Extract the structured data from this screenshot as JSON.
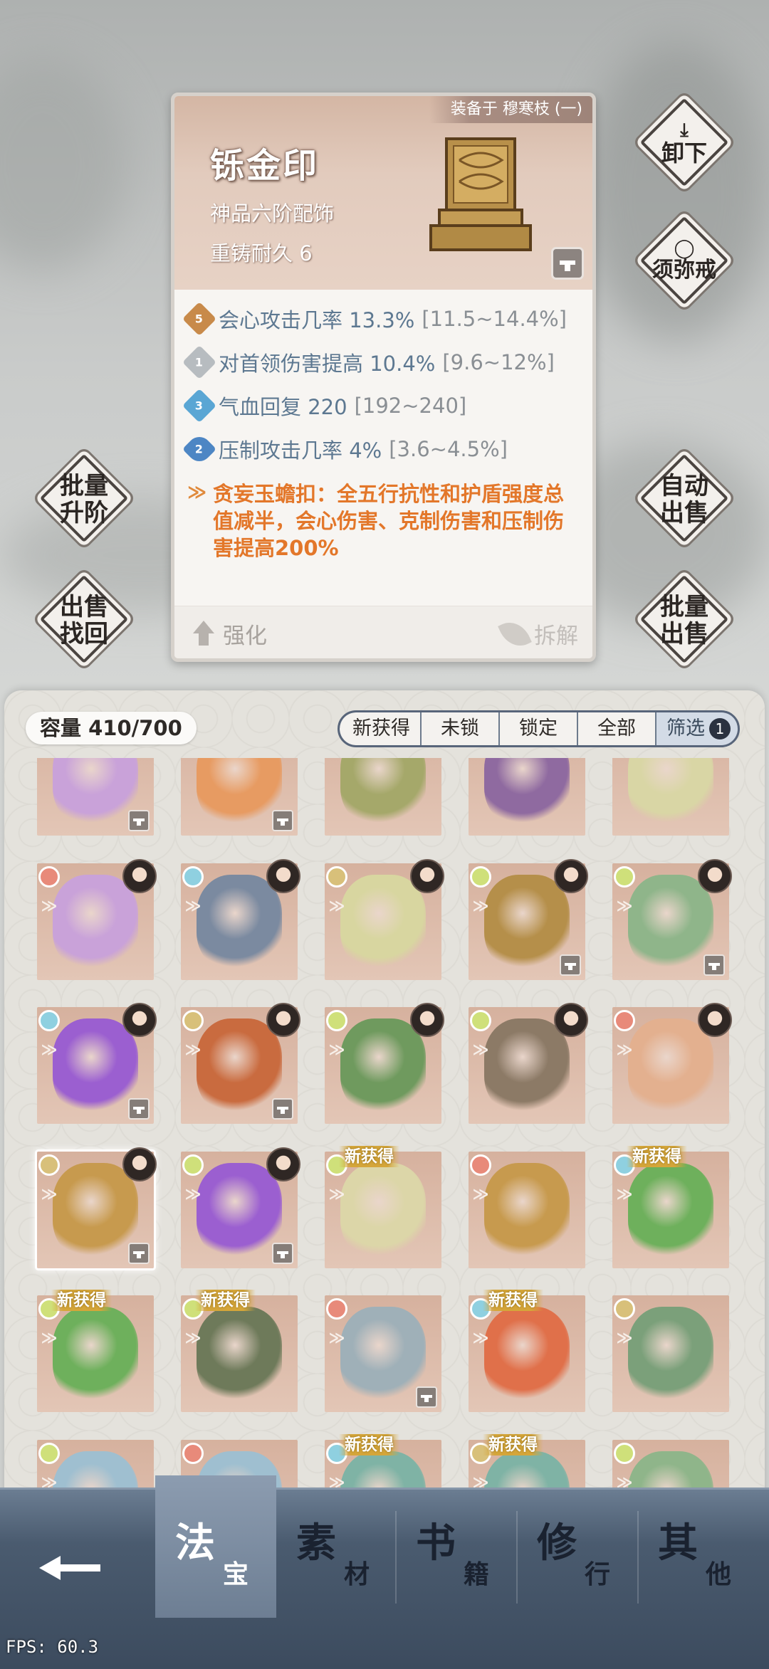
{
  "item": {
    "equipped_by": "装备于 穆寒枝 (一)",
    "name": "铄金印",
    "grade": "神品六阶配饰",
    "durability": "重铸耐久 6",
    "stats": [
      {
        "badge": "5",
        "text": "会心攻击几率 13.3%",
        "range": "[11.5~14.4%]",
        "color": "#c88a4a"
      },
      {
        "badge": "1",
        "text": "对首领伤害提高 10.4%",
        "range": "[9.6~12%]",
        "color": "#b7bcc0"
      },
      {
        "badge": "3",
        "text": "气血回复 220",
        "range": "[192~240]",
        "color": "#5aa6d4"
      },
      {
        "badge": "2",
        "text": "压制攻击几率 4%",
        "range": "[3.6~4.5%]",
        "color": "#4d86c4"
      }
    ],
    "set_effect": "贪妄玉蟾扣：全五行抗性和护盾强度总值减半，会心伤害、克制伤害和压制伤害提高200%",
    "enhance": "强化",
    "disassemble": "拆解"
  },
  "side_buttons": {
    "unequip": "卸下",
    "ring": "须弥戒",
    "batch_upgrade": "批量升阶",
    "auto_sell": "自动出售",
    "sell_recover": "出售找回",
    "batch_sell": "批量出售"
  },
  "inventory": {
    "capacity": "容量 410/700",
    "filters": [
      "新获得",
      "未锁定",
      "锁定",
      "全部"
    ],
    "filter_btn": "筛选",
    "filter_count": "1",
    "new_label": "新获得"
  },
  "tabs": [
    {
      "a": "法",
      "b": "宝"
    },
    {
      "a": "素",
      "b": "材"
    },
    {
      "a": "书",
      "b": "籍"
    },
    {
      "a": "修",
      "b": "行"
    },
    {
      "a": "其",
      "b": "他"
    }
  ],
  "fps": "FPS: 60.3",
  "colors": {
    "accent": "#e3772a",
    "stat": "#5d7891",
    "nav": "#4a5b6f"
  }
}
